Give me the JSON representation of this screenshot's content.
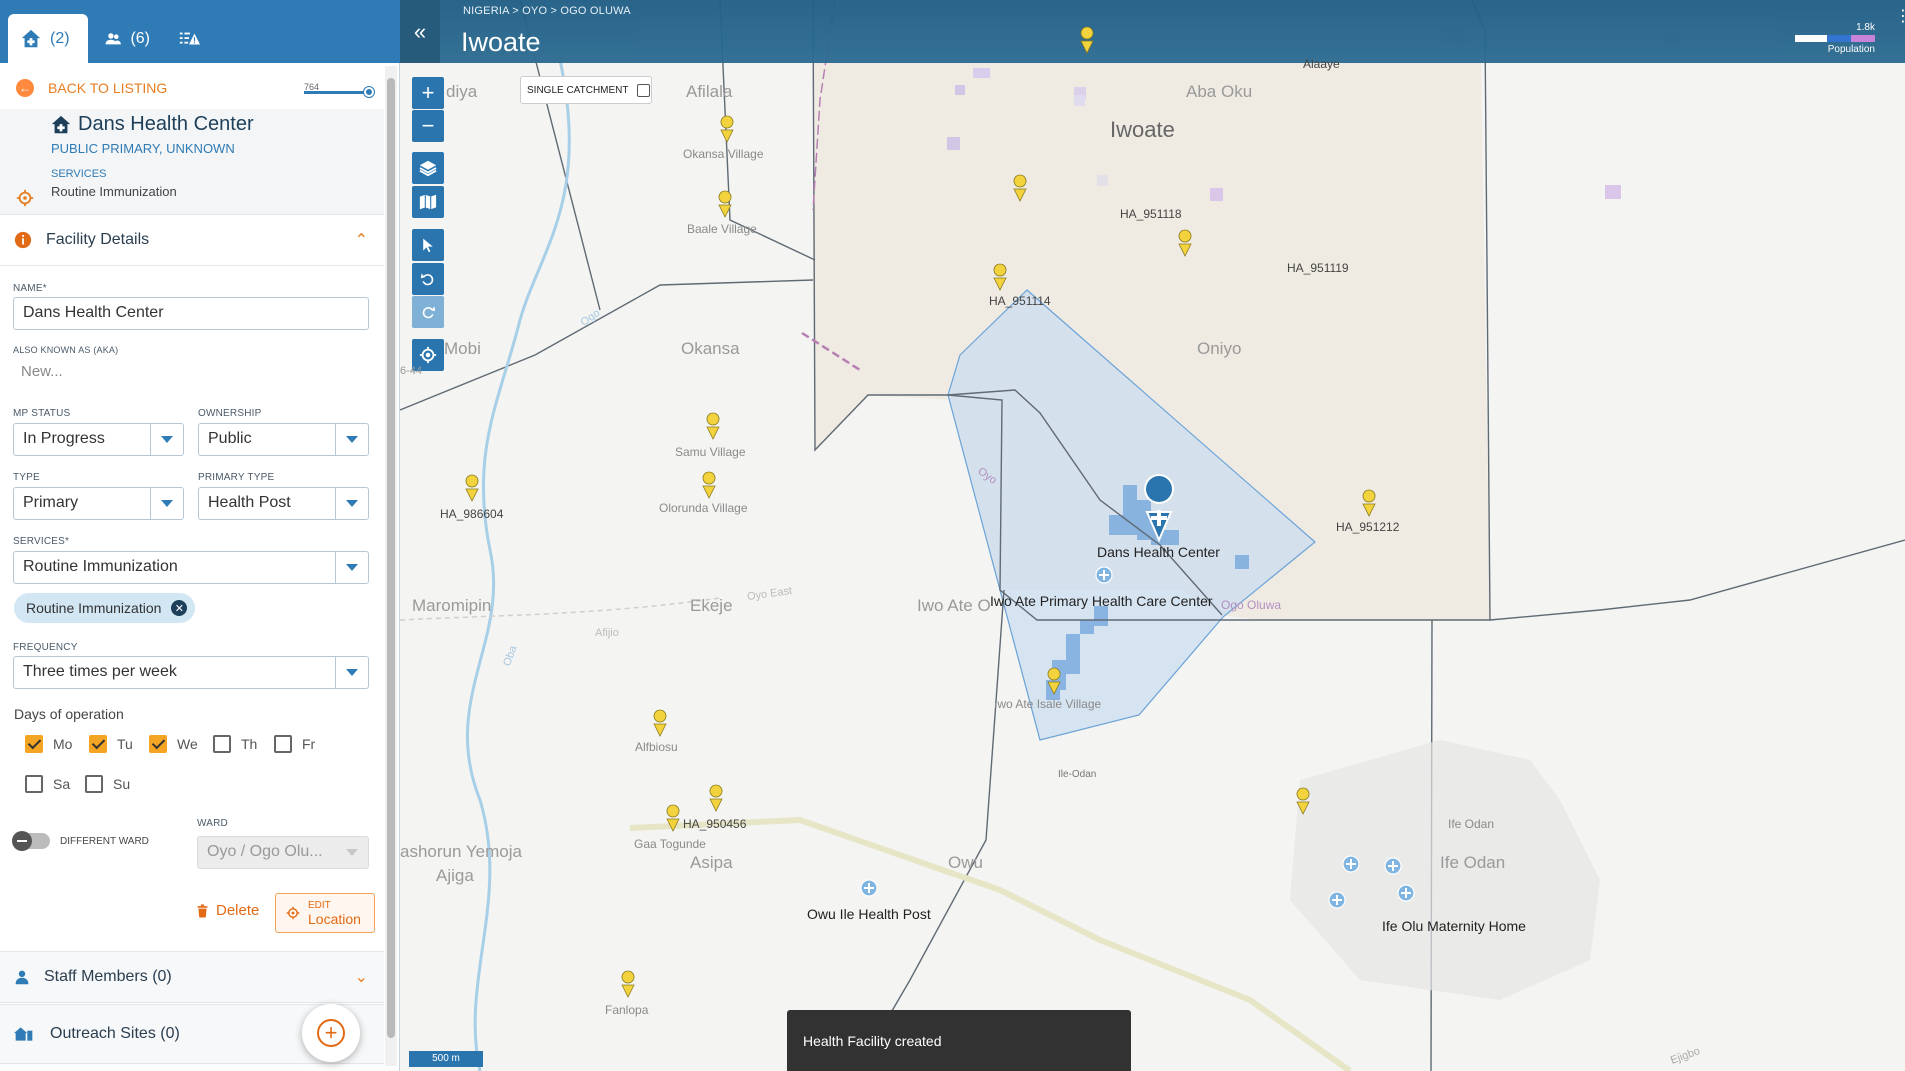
{
  "sidebar": {
    "tabs": [
      {
        "icon": "facility-icon",
        "count": "(2)"
      },
      {
        "icon": "people-icon",
        "count": "(6)"
      },
      {
        "icon": "alert-list-icon",
        "count": ""
      }
    ],
    "back_label": "BACK TO LISTING",
    "slider_value": "764",
    "facility": {
      "name": "Dans Health Center",
      "subtitle": "PUBLIC PRIMARY, UNKNOWN",
      "services_label": "SERVICES",
      "services_value": "Routine Immunization"
    },
    "details": {
      "section_title": "Facility Details",
      "name_label": "NAME*",
      "name_value": "Dans Health Center",
      "aka_label": "ALSO KNOWN AS (AKA)",
      "aka_placeholder": "New...",
      "mp_status_label": "MP STATUS",
      "mp_status_value": "In Progress",
      "ownership_label": "OWNERSHIP",
      "ownership_value": "Public",
      "type_label": "TYPE",
      "type_value": "Primary",
      "primary_type_label": "PRIMARY TYPE",
      "primary_type_value": "Health Post",
      "services_label": "SERVICES*",
      "services_value": "Routine Immunization",
      "services_chip": "Routine Immunization",
      "frequency_label": "FREQUENCY",
      "frequency_value": "Three times per week",
      "days_title": "Days of operation",
      "days": [
        {
          "label": "Mo",
          "checked": true
        },
        {
          "label": "Tu",
          "checked": true
        },
        {
          "label": "We",
          "checked": true
        },
        {
          "label": "Th",
          "checked": false
        },
        {
          "label": "Fr",
          "checked": false
        },
        {
          "label": "Sa",
          "checked": false
        },
        {
          "label": "Su",
          "checked": false
        }
      ],
      "different_ward_label": "DIFFERENT WARD",
      "ward_label": "WARD",
      "ward_value": "Oyo / Ogo Olu...",
      "delete_label": "Delete",
      "edit_top": "EDIT",
      "edit_bottom": "Location"
    },
    "staff_label": "Staff Members (0)",
    "outreach_label": "Outreach Sites (0)"
  },
  "map": {
    "breadcrumb": "NIGERIA  >  OYO  >  OGO OLUWA",
    "title": "Iwoate",
    "legend_value": "1.8k",
    "legend_label": "Population",
    "single_catchment_label": "SINGLE CATCHMENT",
    "scale_label": "500 m",
    "snackbar": "Health Facility created",
    "places": {
      "iwoate": "Iwoate",
      "aba_oku": "Aba Oku",
      "oniyo": "Oniyo",
      "okansa": "Okansa",
      "maromipin": "Maromipin",
      "ekeje": "Ekeje",
      "iwo_ate": "Iwo Ate O",
      "owu": "Owu",
      "asipa": "Asipa",
      "ife_odan_big": "Ife Odan",
      "afilala": "Afilala",
      "adiya": "diya",
      "mobi": "Mobi",
      "ashorun": "ashorun Yemoja",
      "ajiga": "Ajiga",
      "ile_odan": "Ile-Odan"
    },
    "villages": {
      "okansa_village": "Okansa Village",
      "baale_village": "Baale Village",
      "samu_village": "Samu Village",
      "olorunda_village": "Olorunda Village",
      "iwo_ate_isale": "Iwo Ate Isale Village",
      "alfbiosu": "Alfbiosu",
      "gaa_togunde": "Gaa Togunde",
      "fanlopa": "Fanlopa",
      "ife_odan": "Ife Odan",
      "alaaye": "Alaaye"
    },
    "ha": {
      "ha1": "HA_951118",
      "ha2": "HA_951119",
      "ha3": "HA_951114",
      "ha4": "HA_986604",
      "ha5": "HA_951212",
      "ha6": "HA_950456"
    },
    "facilities": {
      "dans": "Dans Health Center",
      "iwo_ate_phc": "Iwo Ate Primary Health Care Center",
      "owu_ile": "Owu Ile Health Post",
      "ife_olu": "Ife Olu Maternity Home"
    },
    "rivers": {
      "oyo": "Oyo",
      "oyo_east": "Oyo East",
      "ogo_oluwa": "Ogo Oluwa",
      "ogo": "Ogo",
      "afijio": "Afijio",
      "oba": "Oba",
      "ejigbo": "Ejigbo",
      "sixty": "6-44"
    }
  },
  "colors": {
    "primary": "#2f7bb5",
    "accent": "#e67e22",
    "checkbox_on": "#f5a524",
    "pin_yellow": "#f2d33d"
  }
}
